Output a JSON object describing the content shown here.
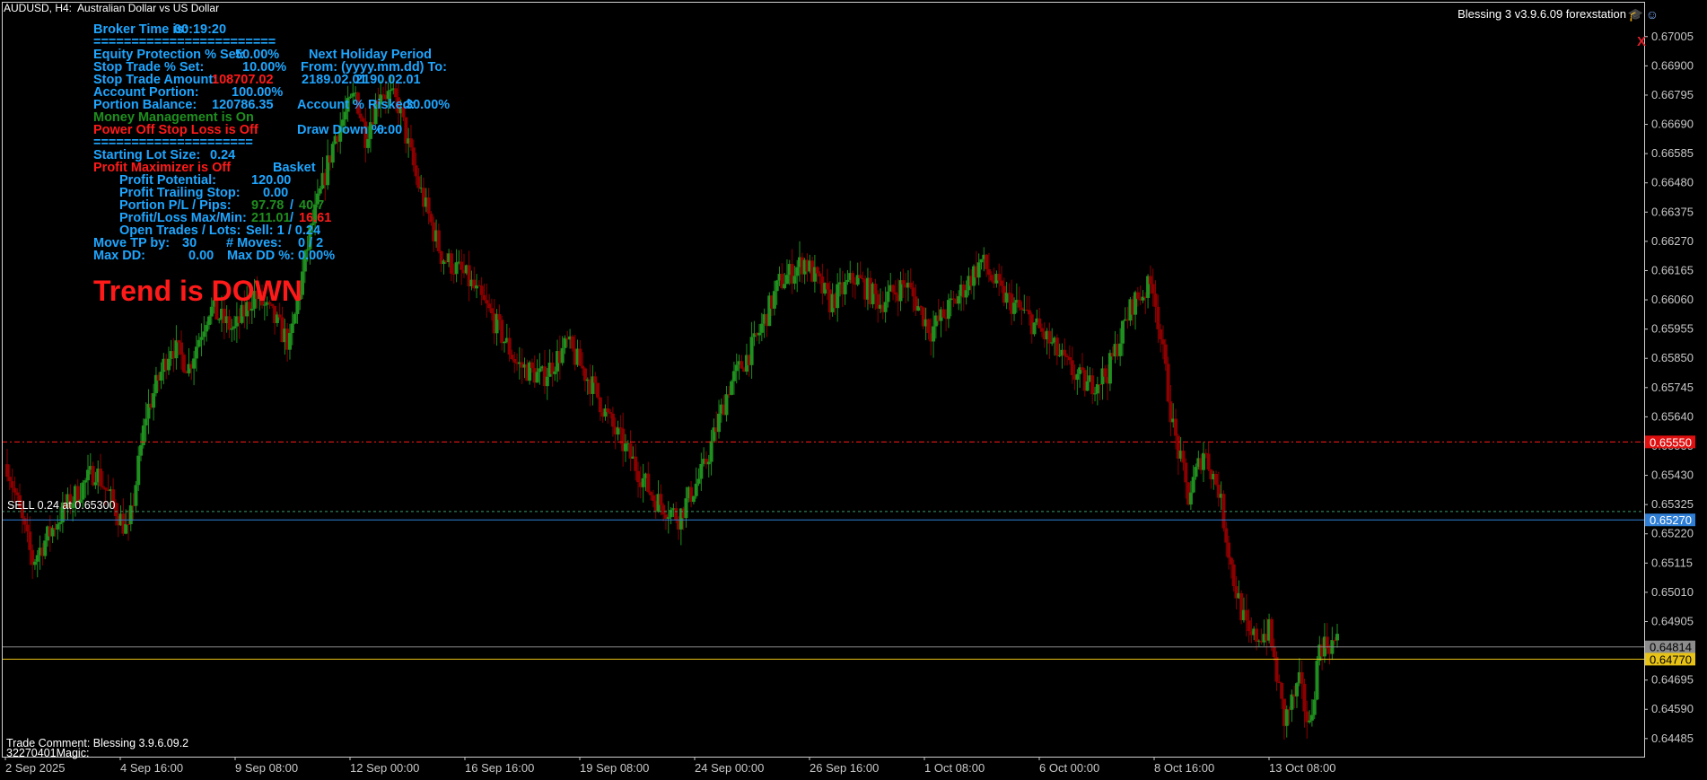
{
  "header": {
    "symbol": "AUDUSD, H4:",
    "description": "Australian Dollar vs US Dollar"
  },
  "ea": {
    "name": "Blessing 3 v3.9.6.09 forexstation",
    "icons": [
      "graduation-cap-icon",
      "smiley-icon"
    ],
    "close": "X"
  },
  "colors": {
    "bull": "#1f8f1f",
    "bear": "#8b0000",
    "panel_blue": "#1fa6ff",
    "red": "#ff1a1a",
    "green": "#1f8f1f",
    "stop_line": "#ff1a1a",
    "blue_line": "#2f7fd6",
    "gray_line": "#8c8c8c",
    "yellow_line": "#e8c317",
    "axis": "#c8c8c8"
  },
  "panel": {
    "broker_time_label": "Broker Time is:",
    "broker_time": "00:19:20",
    "sep1": "========================",
    "equity_protection_label": "Equity Protection % Set:",
    "equity_protection": "50.00%",
    "stop_trade_label": "Stop Trade % Set:",
    "stop_trade": "10.00%",
    "stop_amount_label": "Stop Trade Amount:",
    "stop_amount": "108707.02",
    "account_portion_label": "Account Portion:",
    "account_portion": "100.00%",
    "portion_balance_label": "Portion Balance:",
    "portion_balance": "120786.35",
    "money_mgmt": "Money Management is On",
    "power_off": "Power Off Stop Loss is Off",
    "sep2": "=====================",
    "holiday_title": "Next Holiday Period",
    "holiday_from_label": "From: (yyyy.mm.dd) To:",
    "holiday_from": "2189.02.01",
    "holiday_to": "2190.02.01",
    "account_risked_label": "Account % Risked:",
    "account_risked": "30.00%",
    "draw_down_label": "Draw Down %:",
    "draw_down": "0.00",
    "starting_lot_label": "Starting Lot Size:",
    "starting_lot": "0.24",
    "profit_maximizer": "Profit Maximizer is Off",
    "basket": "Basket",
    "profit_potential_label": "Profit Potential:",
    "profit_potential": "120.00",
    "profit_trailing_label": "Profit Trailing Stop:",
    "profit_trailing": "0.00",
    "portion_pl_label": "Portion P/L / Pips:",
    "portion_pl": "97.78",
    "portion_pips_sep": "/",
    "portion_pips": "40.7",
    "pl_maxmin_label": "Profit/Loss Max/Min:",
    "pl_max": "211.01",
    "pl_sep": "/",
    "pl_min": "16.61",
    "open_trades_label": "Open Trades / Lots:",
    "open_trades": "Sell:  1 / 0.24",
    "move_tp_label": "Move TP by:",
    "move_tp": "30",
    "moves_label": "# Moves:",
    "moves": "0 / 2",
    "max_dd_label": "Max DD:",
    "max_dd": "0.00",
    "max_dd_pct_label": "Max DD %:",
    "max_dd_pct": "0.00%"
  },
  "trend": "Trend is DOWN",
  "sell_line_label": "SELL 0.24 at 0.65300",
  "trade_comment": "Trade Comment: Blessing 3.9.6.09.2",
  "magic": "32270401Magic:",
  "price_axis": {
    "labels": [
      "0.67005",
      "0.66900",
      "0.66795",
      "0.66690",
      "0.66585",
      "0.66480",
      "0.66375",
      "0.66270",
      "0.66165",
      "0.66060",
      "0.65955",
      "0.65850",
      "0.65745",
      "0.65640",
      "0.65535",
      "0.65430",
      "0.65325",
      "0.65220",
      "0.65115",
      "0.65010",
      "0.64905",
      "0.64800",
      "0.64695",
      "0.64590",
      "0.64485"
    ],
    "tags": [
      {
        "text": "0.65550",
        "price": 0.6555,
        "bg": "#e01010",
        "fg": "#ffffff"
      },
      {
        "text": "0.65270",
        "price": 0.6527,
        "bg": "#2f7fd6",
        "fg": "#ffffff"
      },
      {
        "text": "0.64814",
        "price": 0.64814,
        "bg": "#8c8c8c",
        "fg": "#000000"
      },
      {
        "text": "0.64770",
        "price": 0.6477,
        "bg": "#e8c317",
        "fg": "#000000"
      }
    ]
  },
  "time_axis": {
    "labels": [
      "2 Sep 2025",
      "4 Sep 16:00",
      "9 Sep 08:00",
      "12 Sep 00:00",
      "16 Sep 16:00",
      "19 Sep 08:00",
      "24 Sep 00:00",
      "26 Sep 16:00",
      "1 Oct 08:00",
      "6 Oct 00:00",
      "8 Oct 16:00",
      "13 Oct 08:00"
    ]
  },
  "lines": {
    "stop_price": 0.6555,
    "sell_price": 0.653,
    "blue_price": 0.6527,
    "gray_price": 0.64814,
    "yellow_price": 0.6477
  },
  "candle_path": [
    [
      0,
      0.6547
    ],
    [
      10,
      0.6512
    ],
    [
      22,
      0.653
    ],
    [
      35,
      0.6545
    ],
    [
      48,
      0.6522
    ],
    [
      55,
      0.6565
    ],
    [
      65,
      0.659
    ],
    [
      72,
      0.6582
    ],
    [
      80,
      0.6603
    ],
    [
      90,
      0.6595
    ],
    [
      98,
      0.6608
    ],
    [
      105,
      0.66
    ],
    [
      112,
      0.659
    ],
    [
      120,
      0.663
    ],
    [
      130,
      0.6665
    ],
    [
      138,
      0.668
    ],
    [
      142,
      0.6665
    ],
    [
      148,
      0.6682
    ],
    [
      155,
      0.6676
    ],
    [
      162,
      0.665
    ],
    [
      172,
      0.6622
    ],
    [
      182,
      0.6614
    ],
    [
      192,
      0.66
    ],
    [
      202,
      0.6583
    ],
    [
      212,
      0.6578
    ],
    [
      222,
      0.659
    ],
    [
      232,
      0.6575
    ],
    [
      240,
      0.656
    ],
    [
      248,
      0.6548
    ],
    [
      256,
      0.6535
    ],
    [
      266,
      0.6528
    ],
    [
      276,
      0.6545
    ],
    [
      286,
      0.6575
    ],
    [
      296,
      0.659
    ],
    [
      306,
      0.6612
    ],
    [
      316,
      0.662
    ],
    [
      326,
      0.6605
    ],
    [
      336,
      0.6614
    ],
    [
      346,
      0.6605
    ],
    [
      356,
      0.6612
    ],
    [
      366,
      0.6595
    ],
    [
      376,
      0.6606
    ],
    [
      386,
      0.662
    ],
    [
      394,
      0.6608
    ],
    [
      404,
      0.66
    ],
    [
      412,
      0.6592
    ],
    [
      420,
      0.6582
    ],
    [
      428,
      0.6575
    ],
    [
      436,
      0.658
    ],
    [
      446,
      0.6605
    ],
    [
      454,
      0.6612
    ],
    [
      462,
      0.656
    ],
    [
      468,
      0.6535
    ],
    [
      474,
      0.6552
    ],
    [
      480,
      0.6538
    ],
    [
      486,
      0.6505
    ],
    [
      492,
      0.6484
    ],
    [
      500,
      0.6487
    ],
    [
      506,
      0.6455
    ],
    [
      512,
      0.6468
    ],
    [
      516,
      0.6452
    ],
    [
      520,
      0.6482
    ],
    [
      527,
      0.6483
    ]
  ],
  "chart_data": {
    "type": "candlestick",
    "symbol": "AUDUSD",
    "timeframe": "H4",
    "y_range": [
      0.6442,
      0.6713
    ],
    "x_labels": [
      "2 Sep 2025",
      "4 Sep 16:00",
      "9 Sep 08:00",
      "12 Sep 00:00",
      "16 Sep 16:00",
      "19 Sep 08:00",
      "24 Sep 00:00",
      "26 Sep 16:00",
      "1 Oct 08:00",
      "6 Oct 00:00",
      "8 Oct 16:00",
      "13 Oct 08:00"
    ],
    "last_price": 0.64814
  }
}
